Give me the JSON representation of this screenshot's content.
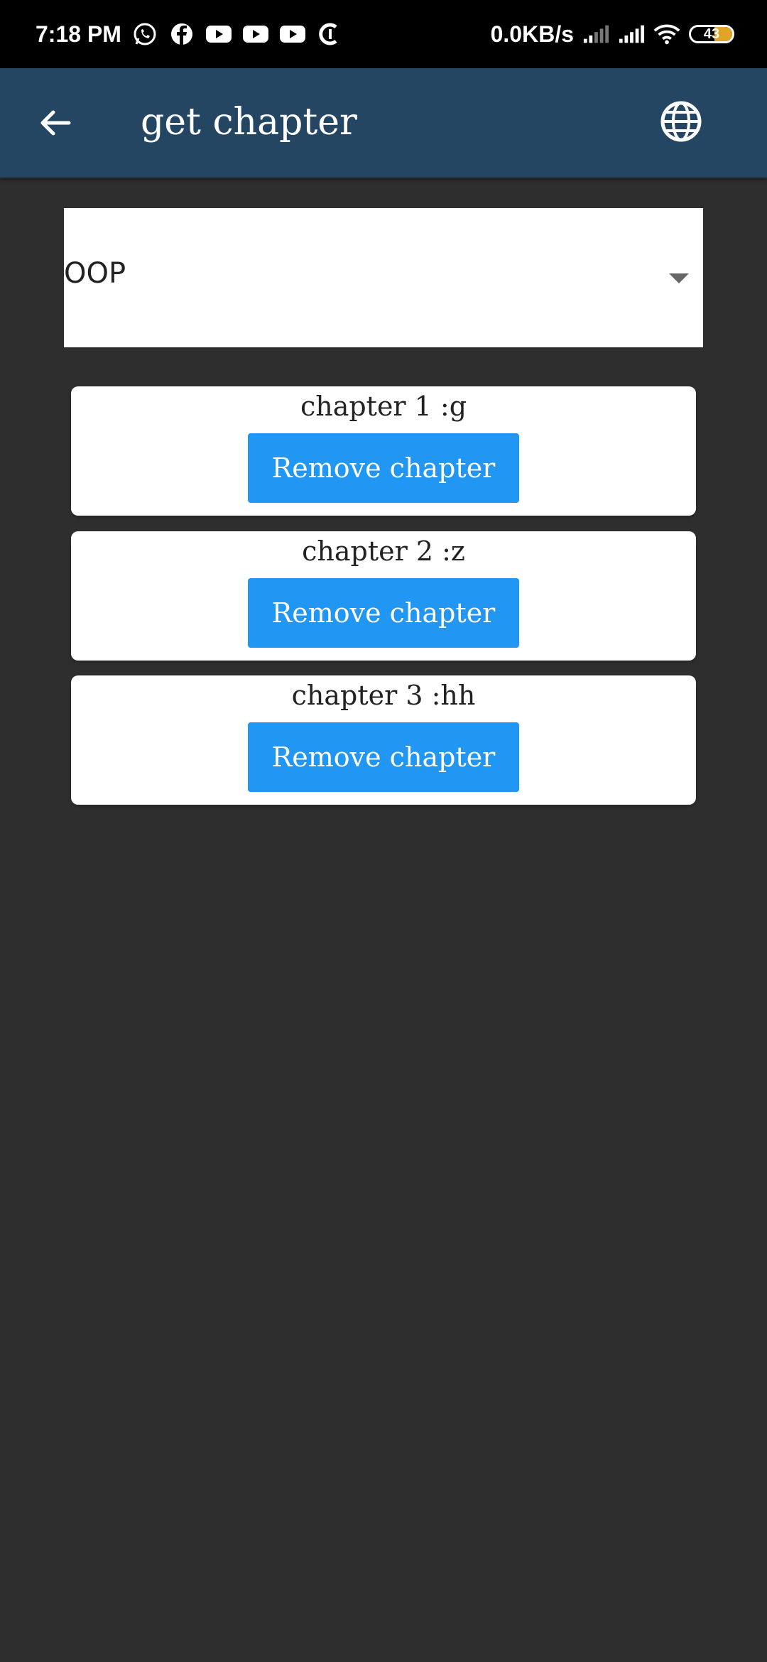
{
  "status_bar": {
    "time": "7:18 PM",
    "network_speed": "0.0KB/s",
    "battery": "43",
    "battery_level": 0.43,
    "notification_icons": [
      "whatsapp-icon",
      "facebook-icon",
      "youtube-icon",
      "youtube-icon",
      "youtube-icon",
      "app-c-icon"
    ],
    "status_icons": [
      "signal-weak-icon",
      "signal-strong-icon",
      "wifi-icon",
      "battery-icon"
    ]
  },
  "app_bar": {
    "title": "get chapter",
    "back_icon": "arrow-left-icon",
    "language_icon": "globe-icon",
    "background_color": "#244662"
  },
  "subject_select": {
    "value": "OOP",
    "icon": "caret-down-icon"
  },
  "chapters": [
    {
      "label": "chapter 1 :g",
      "button_label": "Remove chapter"
    },
    {
      "label": "chapter 2 :z",
      "button_label": "Remove chapter"
    },
    {
      "label": "chapter 3 :hh",
      "button_label": "Remove chapter"
    }
  ],
  "colors": {
    "background": "#2e2e2e",
    "button": "#2196f3",
    "battery_fill": "#e0a526"
  }
}
